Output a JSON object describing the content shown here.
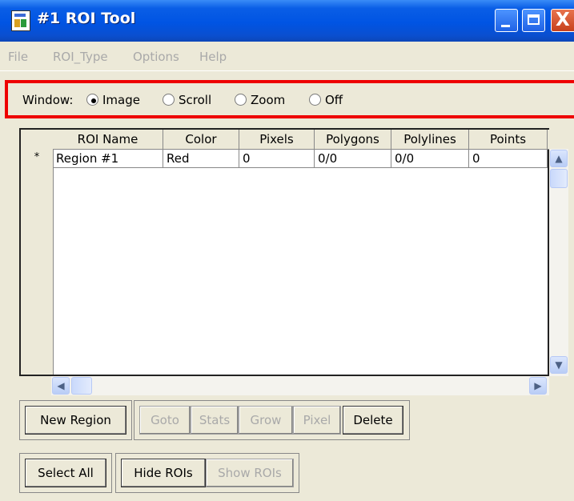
{
  "window": {
    "title": "#1 ROI Tool",
    "title_bar_color": "#0054e3",
    "controls": [
      "minimize-icon",
      "maximize-icon",
      "close-icon"
    ],
    "close_glyph": "X"
  },
  "menu": {
    "items": [
      {
        "label": "File"
      },
      {
        "label": "ROI_Type"
      },
      {
        "label": "Options"
      },
      {
        "label": "Help"
      }
    ],
    "disabled_color": "#a9a9a9"
  },
  "window_selector": {
    "label": "Window:",
    "options": [
      {
        "label": "Image",
        "selected": true
      },
      {
        "label": "Scroll",
        "selected": false
      },
      {
        "label": "Zoom",
        "selected": false
      },
      {
        "label": "Off",
        "selected": false
      }
    ],
    "highlight_color": "#ee0000"
  },
  "table": {
    "columns": [
      "ROI Name",
      "Color",
      "Pixels",
      "Polygons",
      "Polylines",
      "Points"
    ],
    "row_marker": "*",
    "rows": [
      [
        "Region #1",
        "Red",
        "0",
        "0/0",
        "0/0",
        "0"
      ]
    ]
  },
  "scrollbars": {
    "up_glyph": "▲",
    "down_glyph": "▼",
    "left_glyph": "◀",
    "right_glyph": "▶"
  },
  "buttons": {
    "new_region": "New Region",
    "goto": "Goto",
    "stats": "Stats",
    "grow": "Grow",
    "pixel": "Pixel",
    "delete": "Delete",
    "select_all": "Select All",
    "hide_rois": "Hide ROIs",
    "show_rois": "Show ROIs"
  }
}
